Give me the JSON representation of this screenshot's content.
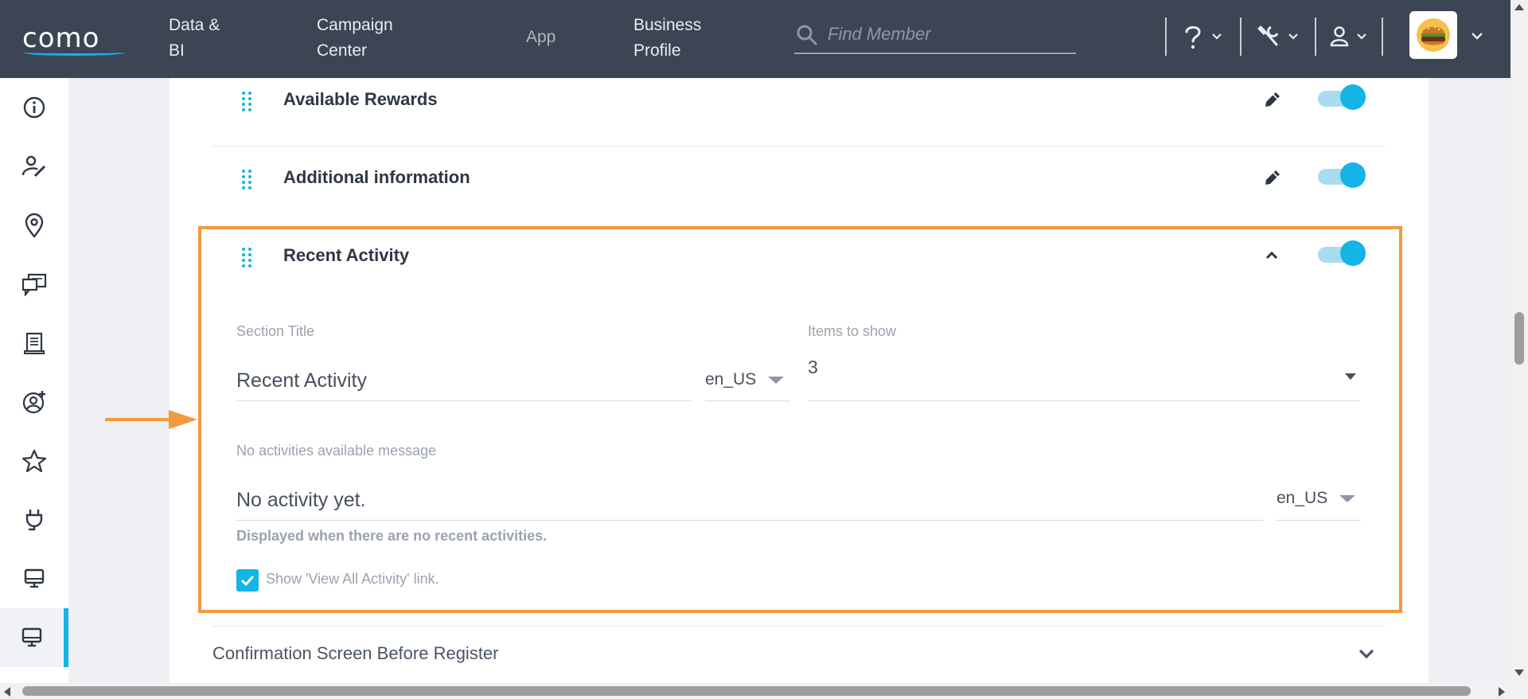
{
  "header": {
    "logo": "como",
    "nav": [
      {
        "label": "Data & BI",
        "lines": [
          "Data &",
          "BI"
        ]
      },
      {
        "label": "Campaign Center",
        "lines": [
          "Campaign",
          "Center"
        ]
      },
      {
        "label": "App"
      },
      {
        "label": "Business Profile",
        "lines": [
          "Business",
          "Profile"
        ]
      }
    ],
    "search_placeholder": "Find Member",
    "icons": [
      "help-icon",
      "wrench-icon",
      "user-icon"
    ],
    "avatar_icon": "burger-logo"
  },
  "sidebar": {
    "items": [
      "info-icon",
      "user-edit-icon",
      "location-pin-icon",
      "chat-icon",
      "receipt-icon",
      "user-add-icon",
      "star-icon",
      "plug-icon",
      "monitor-icon",
      "monitor-icon"
    ],
    "active_index": 9
  },
  "sections": [
    {
      "title": "Available Rewards",
      "enabled": true,
      "expanded": false
    },
    {
      "title": "Additional information",
      "enabled": true,
      "expanded": false
    },
    {
      "title": "Recent Activity",
      "enabled": true,
      "expanded": true
    }
  ],
  "recent_activity": {
    "section_title_label": "Section Title",
    "section_title_value": "Recent Activity",
    "section_title_lang": "en_US",
    "items_label": "Items to show",
    "items_value": "3",
    "no_activity_label": "No activities available message",
    "no_activity_value": "No activity yet.",
    "no_activity_lang": "en_US",
    "no_activity_hint": "Displayed when there are no recent activities.",
    "view_all_label": "Show 'View All Activity' link.",
    "view_all_checked": true
  },
  "next_section": {
    "title": "Confirmation Screen Before Register"
  },
  "colors": {
    "accent": "#14b4e6",
    "highlight": "#f39a3d",
    "nav_bg": "#3b4554"
  }
}
